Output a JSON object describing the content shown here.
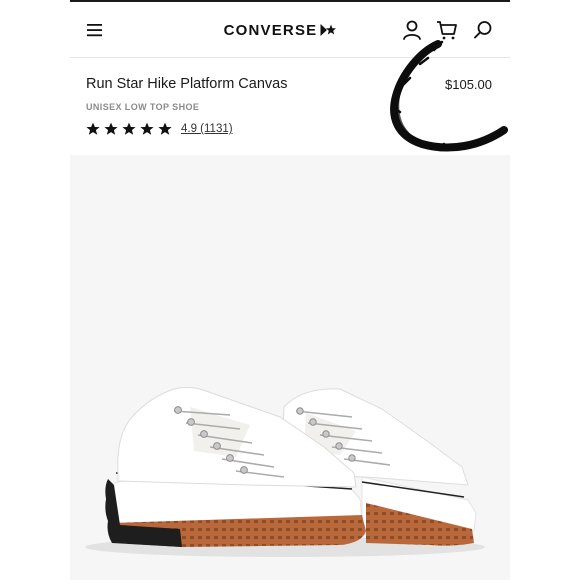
{
  "header": {
    "brand": "CONVERSE",
    "icons": [
      "menu-icon",
      "account-icon",
      "cart-icon",
      "search-icon"
    ]
  },
  "product": {
    "name": "Run Star Hike Platform Canvas",
    "price": "$105.00",
    "category": "UNISEX LOW TOP SHOE",
    "stars": 5,
    "rating_text": "4.9 (1131)"
  },
  "colors": {
    "text": "#1a1a1a",
    "muted": "#8a8a8a",
    "image_background": "#f6f6f6",
    "gum_sole": "#b8683a"
  }
}
